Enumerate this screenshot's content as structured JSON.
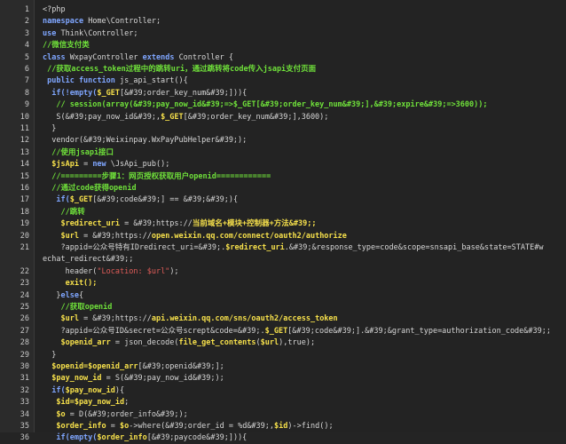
{
  "editor": {
    "lines": [
      {
        "n": "1",
        "parts": [
          {
            "t": "<?php",
            "c": "plain"
          }
        ]
      },
      {
        "n": "2",
        "parts": [
          {
            "t": "namespace ",
            "c": "kw"
          },
          {
            "t": "Home\\Controller;",
            "c": "plain"
          }
        ]
      },
      {
        "n": "3",
        "parts": [
          {
            "t": "use ",
            "c": "kw"
          },
          {
            "t": "Think\\Controller;",
            "c": "plain"
          }
        ]
      },
      {
        "n": "4",
        "parts": [
          {
            "t": "//微信支付类",
            "c": "cmt"
          }
        ]
      },
      {
        "n": "5",
        "parts": [
          {
            "t": "class ",
            "c": "kw"
          },
          {
            "t": "WxpayController ",
            "c": "plain"
          },
          {
            "t": "extends ",
            "c": "kw"
          },
          {
            "t": "Controller {",
            "c": "plain"
          }
        ]
      },
      {
        "n": "6",
        "parts": [
          {
            "t": " //获取access_token过程中的跳转uri，通过跳转将code传入jsapi支付页面",
            "c": "cmt"
          }
        ]
      },
      {
        "n": "7",
        "parts": [
          {
            "t": " public function ",
            "c": "kw"
          },
          {
            "t": "js_api_start(){",
            "c": "plain"
          }
        ]
      },
      {
        "n": "8",
        "parts": [
          {
            "t": "  if(!empty(",
            "c": "kw"
          },
          {
            "t": "$_GET",
            "c": "var"
          },
          {
            "t": "[&#39;order_key_num&#39;])){",
            "c": "plain"
          }
        ]
      },
      {
        "n": "9",
        "parts": [
          {
            "t": "   // session(array(&#39;pay_now_id&#39;=>$_GET[&#39;order_key_num&#39;],&#39;expire&#39;=>3600));",
            "c": "cmt"
          }
        ]
      },
      {
        "n": "10",
        "parts": [
          {
            "t": "   S(&#39;pay_now_id&#39;,",
            "c": "plain"
          },
          {
            "t": "$_GET",
            "c": "var"
          },
          {
            "t": "[&#39;order_key_num&#39;],3600);",
            "c": "plain"
          }
        ]
      },
      {
        "n": "11",
        "parts": [
          {
            "t": "  }",
            "c": "plain"
          }
        ]
      },
      {
        "n": "12",
        "parts": [
          {
            "t": "  vendor(&#39;Weixinpay.WxPayPubHelper&#39;);",
            "c": "plain"
          }
        ]
      },
      {
        "n": "13",
        "parts": [
          {
            "t": "  //使用jsapi接口",
            "c": "cmt"
          }
        ]
      },
      {
        "n": "14",
        "parts": [
          {
            "t": "  $jsApi",
            "c": "var"
          },
          {
            "t": " = ",
            "c": "plain"
          },
          {
            "t": "new ",
            "c": "kw"
          },
          {
            "t": "\\JsApi_pub();",
            "c": "plain"
          }
        ]
      },
      {
        "n": "15",
        "parts": [
          {
            "t": "  //=========步骤1：网页授权获取用户openid============",
            "c": "cmt"
          }
        ]
      },
      {
        "n": "16",
        "parts": [
          {
            "t": "  //通过code获得openid",
            "c": "cmt"
          }
        ]
      },
      {
        "n": "17",
        "parts": [
          {
            "t": "   if(",
            "c": "kw"
          },
          {
            "t": "$_GET",
            "c": "var"
          },
          {
            "t": "[&#39;code&#39;] == &#39;&#39;){",
            "c": "plain"
          }
        ]
      },
      {
        "n": "18",
        "parts": [
          {
            "t": "    //跳转",
            "c": "cmt"
          }
        ]
      },
      {
        "n": "19",
        "parts": [
          {
            "t": "    $redirect_uri",
            "c": "var"
          },
          {
            "t": " = &#39;https://",
            "c": "plain"
          },
          {
            "t": "当前域名+模块+控制器+方法&#39;;",
            "c": "var"
          }
        ]
      },
      {
        "n": "20",
        "parts": [
          {
            "t": "    $url",
            "c": "var"
          },
          {
            "t": " = &#39;https://",
            "c": "plain"
          },
          {
            "t": "open.weixin.qq.com/connect/oauth2/authorize",
            "c": "var"
          }
        ]
      },
      {
        "n": "21",
        "parts": [
          {
            "t": "    ?appid=公众号特有IDredirect_uri=&#39;.",
            "c": "plain"
          },
          {
            "t": "$redirect_uri",
            "c": "var"
          },
          {
            "t": ".&#39;&response_type=code&scope=snsapi_base&state=STATE#w",
            "c": "plain"
          }
        ]
      },
      {
        "n": "",
        "parts": [
          {
            "t": "echat_redirect&#39;;",
            "c": "plain"
          }
        ]
      },
      {
        "n": "22",
        "parts": [
          {
            "t": "     header(",
            "c": "plain"
          },
          {
            "t": "\"Location: $url\"",
            "c": "str"
          },
          {
            "t": ");",
            "c": "plain"
          }
        ]
      },
      {
        "n": "23",
        "parts": [
          {
            "t": "     exit();",
            "c": "var"
          }
        ]
      },
      {
        "n": "24",
        "parts": [
          {
            "t": "   }",
            "c": "plain"
          },
          {
            "t": "else",
            "c": "kw"
          },
          {
            "t": "{",
            "c": "plain"
          }
        ]
      },
      {
        "n": "25",
        "parts": [
          {
            "t": "    //获取openid",
            "c": "cmt"
          }
        ]
      },
      {
        "n": "26",
        "parts": [
          {
            "t": "    $url",
            "c": "var"
          },
          {
            "t": " = &#39;https://",
            "c": "plain"
          },
          {
            "t": "api.weixin.qq.com/sns/oauth2/access_token",
            "c": "var"
          }
        ]
      },
      {
        "n": "27",
        "parts": [
          {
            "t": "    ?appid=公众号ID&secret=公众号scrept&code=&#39;.",
            "c": "plain"
          },
          {
            "t": "$_GET",
            "c": "var"
          },
          {
            "t": "[&#39;code&#39;].&#39;&grant_type=authorization_code&#39;;",
            "c": "plain"
          }
        ]
      },
      {
        "n": "28",
        "parts": [
          {
            "t": "    $openid_arr",
            "c": "var"
          },
          {
            "t": " = json_decode(",
            "c": "plain"
          },
          {
            "t": "file_get_contents",
            "c": "var"
          },
          {
            "t": "(",
            "c": "plain"
          },
          {
            "t": "$url",
            "c": "var"
          },
          {
            "t": "),true);",
            "c": "plain"
          }
        ]
      },
      {
        "n": "29",
        "parts": [
          {
            "t": "  }",
            "c": "plain"
          }
        ]
      },
      {
        "n": "30",
        "parts": [
          {
            "t": "  $openid=$openid_arr",
            "c": "var"
          },
          {
            "t": "[&#39;openid&#39;];",
            "c": "plain"
          }
        ]
      },
      {
        "n": "31",
        "parts": [
          {
            "t": "  $pay_now_id",
            "c": "var"
          },
          {
            "t": " = S(&#39;pay_now_id&#39;);",
            "c": "plain"
          }
        ]
      },
      {
        "n": "32",
        "parts": [
          {
            "t": "  if(",
            "c": "kw"
          },
          {
            "t": "$pay_now_id",
            "c": "var"
          },
          {
            "t": "){",
            "c": "plain"
          }
        ]
      },
      {
        "n": "33",
        "parts": [
          {
            "t": "   $id=$pay_now_id",
            "c": "var"
          },
          {
            "t": ";",
            "c": "plain"
          }
        ]
      },
      {
        "n": "34",
        "parts": [
          {
            "t": "   $o",
            "c": "var"
          },
          {
            "t": " = D(&#39;order_info&#39;);",
            "c": "plain"
          }
        ]
      },
      {
        "n": "35",
        "parts": [
          {
            "t": "   $order_info",
            "c": "var"
          },
          {
            "t": " = ",
            "c": "plain"
          },
          {
            "t": "$o",
            "c": "var"
          },
          {
            "t": "->where(&#39;order_id = %d&#39;,",
            "c": "plain"
          },
          {
            "t": "$id",
            "c": "var"
          },
          {
            "t": ")->find();",
            "c": "plain"
          }
        ]
      },
      {
        "n": "36",
        "parts": [
          {
            "t": "   if(empty(",
            "c": "kw"
          },
          {
            "t": "$order_info",
            "c": "var"
          },
          {
            "t": "[&#39;paycode&#39;])){",
            "c": "plain"
          }
        ]
      }
    ]
  }
}
